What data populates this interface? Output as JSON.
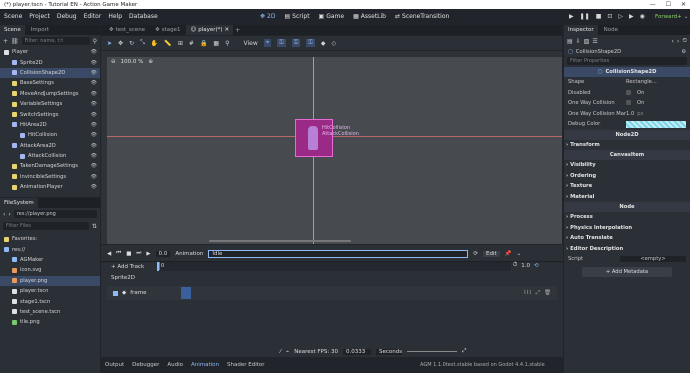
{
  "window": {
    "title": "(*) player.tscn - Tutorial EN - Action Game Maker",
    "controls": [
      "—",
      "☐",
      "✕"
    ]
  },
  "menu": [
    "Scene",
    "Project",
    "Debug",
    "Editor",
    "Help",
    "Database"
  ],
  "workspaces": [
    {
      "label": "2D",
      "active": true
    },
    {
      "label": "Script"
    },
    {
      "label": "Game"
    },
    {
      "label": "AssetLib"
    },
    {
      "label": "SceneTransition"
    }
  ],
  "renderer": "Forward+",
  "scene_panel": {
    "tabs": [
      "Scene",
      "Import"
    ],
    "filter_placeholder": "Filter: name, t:t",
    "nodes": [
      {
        "label": "Player",
        "depth": 0,
        "color": "#e0e0e0"
      },
      {
        "label": "Sprite2D",
        "depth": 1,
        "color": "#a5b7f3"
      },
      {
        "label": "CollisionShape2D",
        "depth": 1,
        "color": "#a5b7f3",
        "selected": true
      },
      {
        "label": "BaseSettings",
        "depth": 1,
        "color": "#e8d46e"
      },
      {
        "label": "MoveAndJumpSettings",
        "depth": 1,
        "color": "#e8d46e"
      },
      {
        "label": "VariableSettings",
        "depth": 1,
        "color": "#e8d46e"
      },
      {
        "label": "SwitchSettings",
        "depth": 1,
        "color": "#e8d46e"
      },
      {
        "label": "HitArea2D",
        "depth": 1,
        "color": "#a5b7f3"
      },
      {
        "label": "HitCollision",
        "depth": 2,
        "color": "#a5b7f3"
      },
      {
        "label": "AttackArea2D",
        "depth": 1,
        "color": "#a5b7f3"
      },
      {
        "label": "AttackCollision",
        "depth": 2,
        "color": "#a5b7f3"
      },
      {
        "label": "TakenDamageSettings",
        "depth": 1,
        "color": "#e8d46e"
      },
      {
        "label": "InvincibleSettings",
        "depth": 1,
        "color": "#e8d46e"
      },
      {
        "label": "AnimationPlayer",
        "depth": 1,
        "color": "#e8d46e"
      }
    ]
  },
  "filesystem": {
    "title": "FileSystem",
    "path": "res://player.png",
    "filter_placeholder": "Filter Files",
    "items": [
      {
        "label": "Favorites:",
        "depth": 0,
        "color": "#e8d46e"
      },
      {
        "label": "res://",
        "depth": 0,
        "color": "#8fbaf5"
      },
      {
        "label": "AGMaker",
        "depth": 1,
        "color": "#8fbaf5"
      },
      {
        "label": "icon.svg",
        "depth": 1,
        "color": "#e89a5a"
      },
      {
        "label": "player.png",
        "depth": 1,
        "color": "#e89a5a",
        "selected": true
      },
      {
        "label": "player.tscn",
        "depth": 1,
        "color": "#e0e0e0"
      },
      {
        "label": "stage1.tscn",
        "depth": 1,
        "color": "#e0e0e0"
      },
      {
        "label": "test_scene.tscn",
        "depth": 1,
        "color": "#e0e0e0"
      },
      {
        "label": "tile.png",
        "depth": 1,
        "color": "#7ac86e"
      }
    ]
  },
  "editor_tabs": [
    {
      "label": "test_scene"
    },
    {
      "label": "stage1"
    },
    {
      "label": "player(*)",
      "active": true
    }
  ],
  "viewport": {
    "view_label": "View",
    "zoom": "100.0 %",
    "overlay_labels": [
      "HitCollision",
      "AttackCollision"
    ]
  },
  "animation": {
    "time": "0.0",
    "label": "Animation",
    "current": "Idle",
    "edit": "Edit",
    "length": "1.0",
    "add_track": "+ Add Track",
    "ticks": [
      "0"
    ],
    "track_group": "Sprite2D",
    "track_name": "frame",
    "snap_label": "Nearest FPS: 30",
    "snap_value": "0.0333",
    "time_unit": "Seconds"
  },
  "bottom_tabs": [
    {
      "label": "Output"
    },
    {
      "label": "Debugger"
    },
    {
      "label": "Audio"
    },
    {
      "label": "Animation",
      "active": true
    },
    {
      "label": "Shader Editor"
    }
  ],
  "version": "AGM 1.1.0test.stable based on Godot 4.4.1.stable",
  "inspector": {
    "tabs": [
      "Inspector",
      "Node"
    ],
    "node": "CollisionShape2D",
    "filter_placeholder": "Filter Properties",
    "class_header": "CollisionShape2D",
    "props": [
      {
        "label": "Shape",
        "value": "Rectangle..."
      },
      {
        "label": "Disabled",
        "value": "On"
      },
      {
        "label": "One Way Collision",
        "value": "On"
      },
      {
        "label": "One Way Collision Mar",
        "value": "1.0",
        "unit": "px"
      },
      {
        "label": "Debug Color",
        "value": ""
      }
    ],
    "node2d": "Node2D",
    "transform": "Transform",
    "canvasitem": "CanvasItem",
    "ci_sections": [
      "Visibility",
      "Ordering",
      "Texture",
      "Material"
    ],
    "node_header": "Node",
    "node_sections": [
      "Process",
      "Physics Interpolation",
      "Auto Translate",
      "Editor Description"
    ],
    "script_label": "Script",
    "script_value": "<empty>",
    "add_metadata": "+ Add Metadata"
  },
  "colors": {
    "accent": "#8fbaf5",
    "selection": "#3a4a66",
    "debug": "#9fe3f0"
  }
}
